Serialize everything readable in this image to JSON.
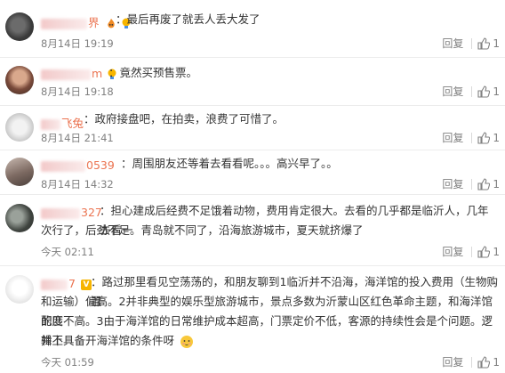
{
  "colors": {
    "username": "#eb7350",
    "meta": "#808080",
    "text": "#333333",
    "divider": "#ececec"
  },
  "comments": [
    {
      "username_tail": "界",
      "text": "最后再废了就丢人丢大发了",
      "time": "8月14日 19:19",
      "reply": "回复",
      "likes": "1"
    },
    {
      "username_tail": "m",
      "text": "竟然买预售票。",
      "time": "8月14日 19:18",
      "reply": "回复",
      "likes": "1"
    },
    {
      "username_tail": "飞兔",
      "text": "政府接盘吧，在拍卖，浪费了可惜了。",
      "time": "8月14日 21:41",
      "reply": "回复",
      "likes": "1"
    },
    {
      "username_tail": "0539",
      "text": "周围朋友还等着去看看呢。。。高兴早了。。",
      "time": "8月14日 14:32",
      "reply": "回复",
      "likes": "1"
    },
    {
      "username_tail": "327",
      "text_line1": "担心建成后经费不足饿着动物，费用肯定很大。去看的几乎都是临沂人，几年去看一",
      "text_line2": "次行了，后劲不足。青岛就不同了，沿海旅游城市，夏天就挤爆了",
      "time": "今天 02:11",
      "reply": "回复",
      "likes": "1"
    },
    {
      "username_tail": "7",
      "text_line1": "路过那里看见空荡荡的，和朋友聊到1临沂并不沿海，海洋馆的投入费用（生物购置",
      "text_line2": "和运输）偏高。2并非典型的娱乐型旅游城市，景点多数为沂蒙山区红色革命主题，和海洋馆的匹",
      "text_line3": "配度不高。3由于海洋馆的日常维护成本超高，门票定价不低，客源的持续性会是个问题。逻辑上",
      "text_line4": "并不具备开海洋馆的条件呀",
      "time": "今天 01:59",
      "reply": "回复",
      "likes": "1"
    }
  ]
}
